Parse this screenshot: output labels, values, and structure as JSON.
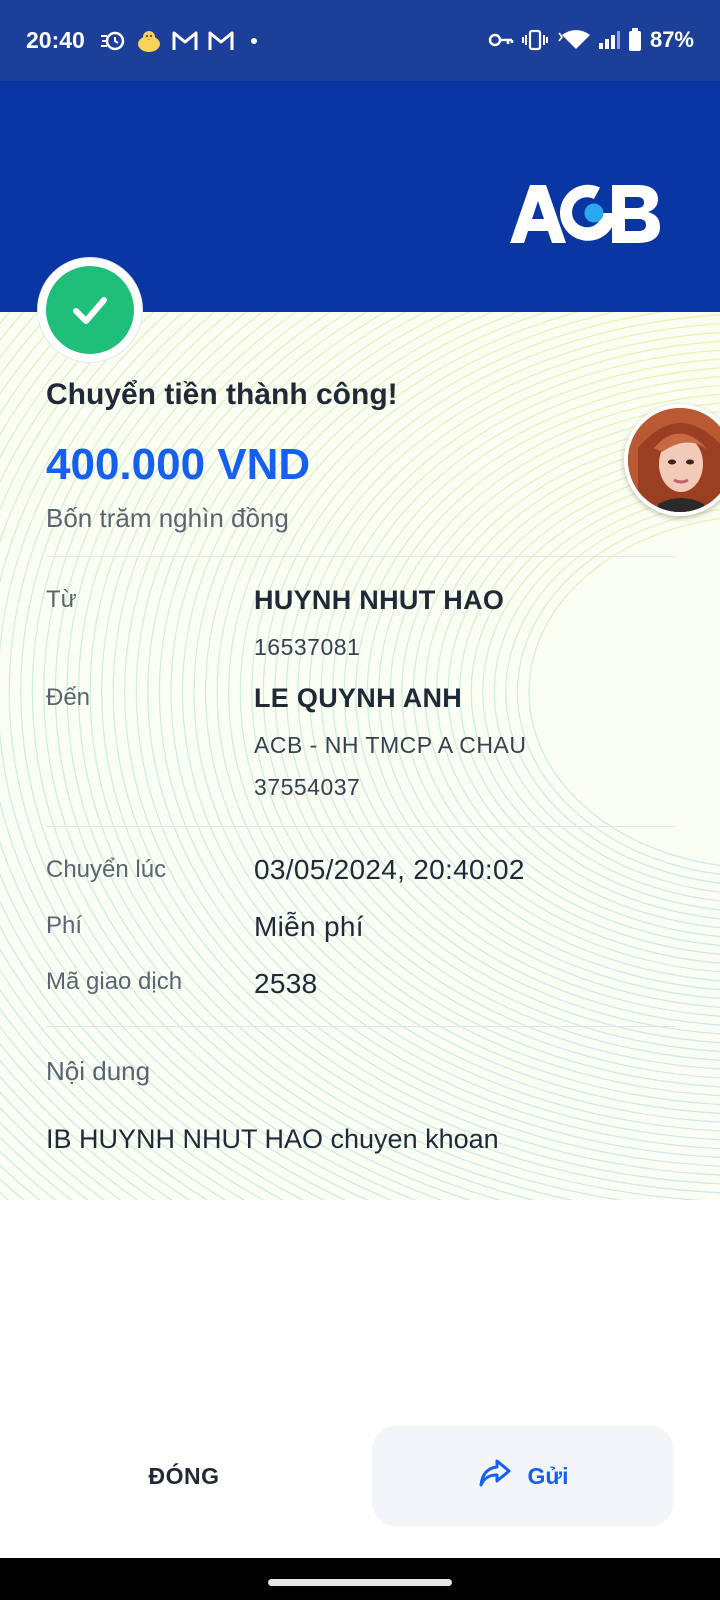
{
  "status_bar": {
    "time": "20:40",
    "battery": "87%",
    "left_icons": [
      "alarm-icon",
      "chick-icon",
      "gmail-icon",
      "gmail-icon",
      "dot-icon"
    ],
    "right_icons": [
      "key-icon",
      "vibrate-icon",
      "wifi-icon",
      "signal-icon",
      "battery-icon"
    ]
  },
  "header": {
    "logo_text": "ACB",
    "background": "#0a36a3"
  },
  "result": {
    "title": "Chuyển tiền thành công!",
    "amount": "400.000 VND",
    "amount_in_words": "Bốn trăm nghìn đồng",
    "status_color": "#1fbf7a",
    "amount_color": "#1560f0"
  },
  "from": {
    "label": "Từ",
    "name": "HUYNH NHUT HAO",
    "account": "16537081"
  },
  "to": {
    "label": "Đến",
    "name": "LE QUYNH ANH",
    "bank": "ACB - NH TMCP A CHAU",
    "account": "37554037"
  },
  "details": {
    "time_label": "Chuyển lúc",
    "time_value": "03/05/2024, 20:40:02",
    "fee_label": "Phí",
    "fee_value": "Miễn phí",
    "txn_label": "Mã giao dịch",
    "txn_value": "2538"
  },
  "memo": {
    "label": "Nội dung",
    "value": "IB HUYNH NHUT HAO chuyen khoan"
  },
  "actions": {
    "close_label": "ĐÓNG",
    "send_label": "Gửi"
  }
}
